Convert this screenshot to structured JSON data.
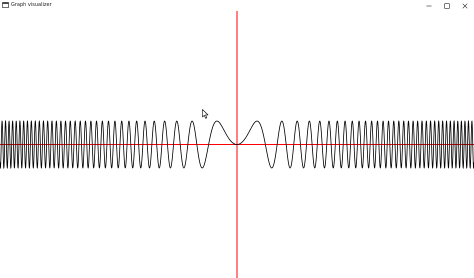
{
  "window": {
    "title": "Graph visualizer",
    "icons": {
      "app": "app-icon",
      "minimize": "minimize-icon",
      "maximize": "maximize-icon",
      "close": "close-icon"
    }
  },
  "graph": {
    "function": "sin(x^2)",
    "x_range": [
      -14.8,
      14.8
    ],
    "y_range": [
      -5.7,
      5.7
    ],
    "axis_color": "#ff0000",
    "curve_color": "#000000",
    "background": "#ffffff"
  },
  "cursor": {
    "icon": "mouse-pointer-icon"
  }
}
